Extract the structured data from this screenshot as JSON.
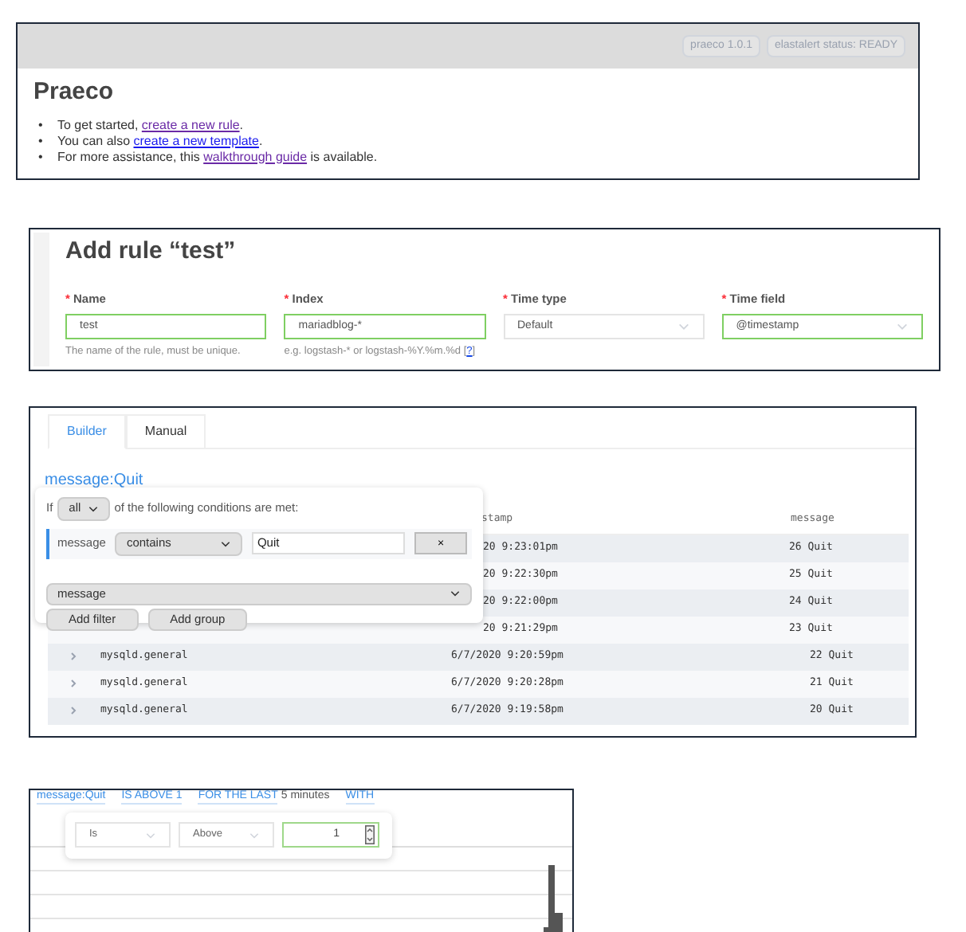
{
  "home": {
    "badges": [
      "praeco 1.0.1",
      "elastalert status: READY"
    ],
    "title": "Praeco",
    "bullets": [
      {
        "marker": "•",
        "before": "To get started, ",
        "link": "create a new rule",
        "after": ".",
        "visited": true
      },
      {
        "marker": "•",
        "before": "You can also ",
        "link": "create a new template",
        "after": ".",
        "visited": false
      },
      {
        "marker": "•",
        "before": "For more assistance, this ",
        "link": "walkthrough guide",
        "after": " is available.",
        "visited": true
      }
    ]
  },
  "rule_form": {
    "title": "Add rule “test”",
    "fields": [
      {
        "required": "*",
        "label": "Name",
        "kind": "input",
        "value": "test",
        "hint": "The name of the rule, must be unique.",
        "valid": true
      },
      {
        "required": "*",
        "label": "Index",
        "kind": "input",
        "value": "mariadblog-*",
        "hint": "e.g. logstash-* or logstash-%Y.%m.%d [",
        "help": "?",
        "help_after": "]",
        "valid": true
      },
      {
        "required": "*",
        "label": "Time type",
        "kind": "select",
        "value": "Default",
        "valid": false
      },
      {
        "required": "*",
        "label": "Time field",
        "kind": "select",
        "value": "@timestamp",
        "valid": true
      }
    ]
  },
  "builder": {
    "tabs": [
      {
        "label": "Builder",
        "selected": true
      },
      {
        "label": "Manual",
        "selected": false
      }
    ],
    "query": "message:Quit",
    "popover": {
      "prefix": "If",
      "match": "all",
      "suffix": "of the following conditions are met:",
      "rule": {
        "field": "message",
        "operator": "contains",
        "value": "Quit",
        "remove": "×"
      },
      "field_select": "message",
      "buttons": [
        "Add filter",
        "Add group"
      ]
    },
    "table": {
      "columns": [
        "stamp",
        "message"
      ],
      "rows": [
        {
          "kind": "covered",
          "timestamp": "20 9:23:01pm",
          "message": "26 Quit"
        },
        {
          "kind": "covered",
          "timestamp": "20 9:22:30pm",
          "message": "25 Quit"
        },
        {
          "kind": "covered",
          "timestamp": "20 9:22:00pm",
          "message": "24 Quit"
        },
        {
          "kind": "covered",
          "timestamp": "20 9:21:29pm",
          "message": "23 Quit"
        },
        {
          "kind": "full",
          "source": "mysqld.general",
          "timestamp": "6/7/2020 9:20:59pm",
          "message": "22 Quit"
        },
        {
          "kind": "full",
          "source": "mysqld.general",
          "timestamp": "6/7/2020 9:20:28pm",
          "message": "21 Quit"
        },
        {
          "kind": "full",
          "source": "mysqld.general",
          "timestamp": "6/7/2020 9:19:58pm",
          "message": "20 Quit"
        }
      ]
    }
  },
  "threshold": {
    "summary": [
      {
        "kind": "link",
        "text": "message:Quit"
      },
      {
        "kind": "link",
        "text": "IS ABOVE 1"
      },
      {
        "kind": "link",
        "text": "FOR THE LAST"
      },
      {
        "kind": "plain",
        "text": "5 minutes"
      },
      {
        "kind": "link",
        "text": "WITH"
      }
    ],
    "selects": [
      "Is",
      "Above"
    ],
    "count": "1"
  }
}
